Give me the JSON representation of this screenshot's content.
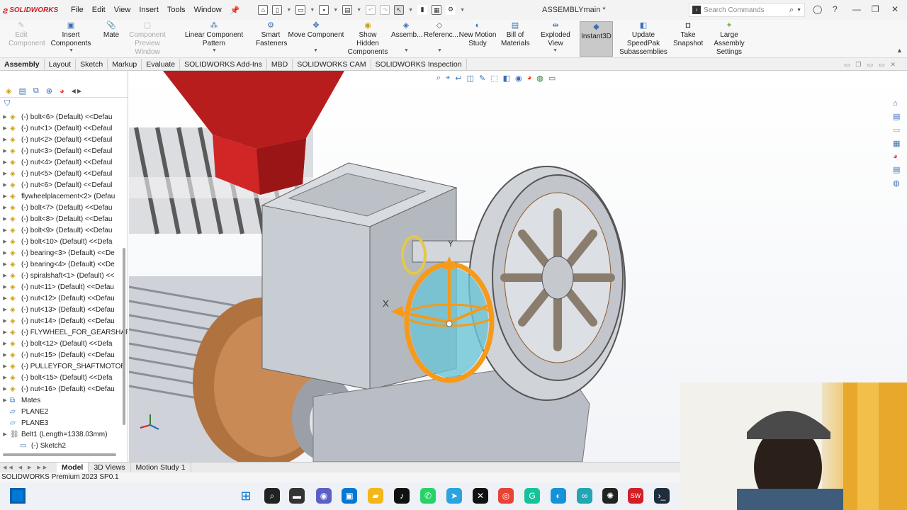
{
  "app": {
    "brand": "SOLIDWORKS",
    "document_title": "ASSEMBLYmain *"
  },
  "menu": [
    "File",
    "Edit",
    "View",
    "Insert",
    "Tools",
    "Window"
  ],
  "search": {
    "placeholder": "Search Commands"
  },
  "command_manager": [
    {
      "label": "Edit\nComponent",
      "state": "disabled",
      "icon": "edit-component-icon"
    },
    {
      "label": "Insert Components",
      "state": "normal",
      "icon": "insert-components-icon"
    },
    {
      "label": "Mate",
      "state": "normal",
      "icon": "mate-icon"
    },
    {
      "label": "Component\nPreview Window",
      "state": "disabled",
      "icon": "preview-window-icon"
    },
    {
      "label": "Linear Component Pattern",
      "state": "normal",
      "icon": "linear-pattern-icon"
    },
    {
      "label": "Smart\nFasteners",
      "state": "normal",
      "icon": "smart-fasteners-icon"
    },
    {
      "label": "Move Component",
      "state": "normal",
      "icon": "move-component-icon"
    },
    {
      "label": "Show Hidden\nComponents",
      "state": "normal",
      "icon": "show-hidden-icon"
    },
    {
      "label": "Assemb...",
      "state": "normal",
      "icon": "assembly-features-icon"
    },
    {
      "label": "Referenc...",
      "state": "normal",
      "icon": "reference-geometry-icon"
    },
    {
      "label": "New Motion\nStudy",
      "state": "normal",
      "icon": "motion-study-icon"
    },
    {
      "label": "Bill of\nMaterials",
      "state": "normal",
      "icon": "bom-icon"
    },
    {
      "label": "Exploded View",
      "state": "normal",
      "icon": "exploded-view-icon"
    },
    {
      "label": "Instant3D",
      "state": "active",
      "icon": "instant3d-icon"
    },
    {
      "label": "Update SpeedPak\nSubassemblies",
      "state": "normal",
      "icon": "speedpak-icon"
    },
    {
      "label": "Take\nSnapshot",
      "state": "normal",
      "icon": "snapshot-icon"
    },
    {
      "label": "Large Assembly\nSettings",
      "state": "normal",
      "icon": "large-assembly-icon"
    }
  ],
  "tabs": [
    {
      "label": "Assembly",
      "active": true
    },
    {
      "label": "Layout",
      "active": false
    },
    {
      "label": "Sketch",
      "active": false
    },
    {
      "label": "Markup",
      "active": false
    },
    {
      "label": "Evaluate",
      "active": false
    },
    {
      "label": "SOLIDWORKS Add-Ins",
      "active": false
    },
    {
      "label": "MBD",
      "active": false
    },
    {
      "label": "SOLIDWORKS CAM",
      "active": false
    },
    {
      "label": "SOLIDWORKS Inspection",
      "active": false
    }
  ],
  "feature_tree": [
    {
      "label": "(-) bolt<6> (Default) <<Defau",
      "type": "part",
      "expandable": true,
      "level": 0
    },
    {
      "label": "(-) nut<1> (Default) <<Defaul",
      "type": "part",
      "expandable": true,
      "level": 0
    },
    {
      "label": "(-) nut<2> (Default) <<Defaul",
      "type": "part",
      "expandable": true,
      "level": 0
    },
    {
      "label": "(-) nut<3> (Default) <<Defaul",
      "type": "part",
      "expandable": true,
      "level": 0
    },
    {
      "label": "(-) nut<4> (Default) <<Defaul",
      "type": "part",
      "expandable": true,
      "level": 0
    },
    {
      "label": "(-) nut<5> (Default) <<Defaul",
      "type": "part",
      "expandable": true,
      "level": 0
    },
    {
      "label": "(-) nut<6> (Default) <<Defaul",
      "type": "part",
      "expandable": true,
      "level": 0
    },
    {
      "label": "flywheelplacement<2> (Defau",
      "type": "part",
      "expandable": true,
      "level": 0
    },
    {
      "label": "(-) bolt<7> (Default) <<Defau",
      "type": "part",
      "expandable": true,
      "level": 0
    },
    {
      "label": "(-) bolt<8> (Default) <<Defau",
      "type": "part",
      "expandable": true,
      "level": 0
    },
    {
      "label": "(-) bolt<9> (Default) <<Defau",
      "type": "part",
      "expandable": true,
      "level": 0
    },
    {
      "label": "(-) bolt<10> (Default) <<Defa",
      "type": "part",
      "expandable": true,
      "level": 0
    },
    {
      "label": "(-) bearing<3> (Default) <<De",
      "type": "part",
      "expandable": true,
      "level": 0
    },
    {
      "label": "(-) bearing<4> (Default) <<De",
      "type": "part",
      "expandable": true,
      "level": 0
    },
    {
      "label": "(-) spiralshaft<1> (Default) <<",
      "type": "part",
      "expandable": true,
      "level": 0
    },
    {
      "label": "(-) nut<11> (Default) <<Defau",
      "type": "part",
      "expandable": true,
      "level": 0
    },
    {
      "label": "(-) nut<12> (Default) <<Defau",
      "type": "part",
      "expandable": true,
      "level": 0
    },
    {
      "label": "(-) nut<13> (Default) <<Defau",
      "type": "part",
      "expandable": true,
      "level": 0
    },
    {
      "label": "(-) nut<14> (Default) <<Defau",
      "type": "part",
      "expandable": true,
      "level": 0
    },
    {
      "label": "(-) FLYWHEEL_FOR_GEARSHAF",
      "type": "part",
      "expandable": true,
      "level": 0
    },
    {
      "label": "(-) bolt<12> (Default) <<Defa",
      "type": "part",
      "expandable": true,
      "level": 0
    },
    {
      "label": "(-) nut<15> (Default) <<Defau",
      "type": "part",
      "expandable": true,
      "level": 0
    },
    {
      "label": "(-) PULLEYFOR_SHAFTMOTOR",
      "type": "part",
      "expandable": true,
      "level": 0
    },
    {
      "label": "(-) bolt<15> (Default) <<Defa",
      "type": "part",
      "expandable": true,
      "level": 0
    },
    {
      "label": "(-) nut<16> (Default) <<Defau",
      "type": "part",
      "expandable": true,
      "level": 0
    },
    {
      "label": "Mates",
      "type": "mates",
      "expandable": true,
      "level": 0
    },
    {
      "label": "PLANE2",
      "type": "plane",
      "expandable": false,
      "level": 0
    },
    {
      "label": "PLANE3",
      "type": "plane",
      "expandable": false,
      "level": 0
    },
    {
      "label": "Belt1 (Length=1338.03mm)",
      "type": "belt",
      "expandable": true,
      "level": 0
    },
    {
      "label": "(-) Sketch2",
      "type": "sketch",
      "expandable": false,
      "level": 1
    }
  ],
  "triad": {
    "x_label": "X",
    "y_label": "Y"
  },
  "bottom_tabs": [
    {
      "label": "Model",
      "active": true
    },
    {
      "label": "3D Views",
      "active": false
    },
    {
      "label": "Motion Study 1",
      "active": false
    }
  ],
  "status_bar": {
    "text": "SOLIDWORKS Premium 2023 SP0.1"
  },
  "taskbar": [
    {
      "name": "start",
      "color": "#0078d4"
    },
    {
      "name": "search-icon",
      "color": "#222222"
    },
    {
      "name": "file-manager-icon",
      "color": "#333333"
    },
    {
      "name": "chat-icon",
      "color": "#5b5fc7"
    },
    {
      "name": "store-icon",
      "color": "#0078d4"
    },
    {
      "name": "folder-icon",
      "color": "#f2b71b"
    },
    {
      "name": "tiktok-icon",
      "color": "#111111"
    },
    {
      "name": "whatsapp-icon",
      "color": "#25d366"
    },
    {
      "name": "telegram-icon",
      "color": "#2aa3df"
    },
    {
      "name": "x-icon",
      "color": "#111111"
    },
    {
      "name": "chrome-icon",
      "color": "#e84335"
    },
    {
      "name": "grammarly-icon",
      "color": "#15c39a"
    },
    {
      "name": "edge-icon",
      "color": "#1593d8"
    },
    {
      "name": "vscode-insiders-icon",
      "color": "#24a5b3"
    },
    {
      "name": "chatgpt-icon",
      "color": "#222222"
    },
    {
      "name": "solidworks-icon",
      "color": "#d21f26"
    },
    {
      "name": "terminal-icon",
      "color": "#1f2d3d"
    }
  ],
  "colors": {
    "accent": "#3b6fb6",
    "brand": "#d21f26",
    "triad": "#f59a1a",
    "hopper": "#b81d1d"
  }
}
